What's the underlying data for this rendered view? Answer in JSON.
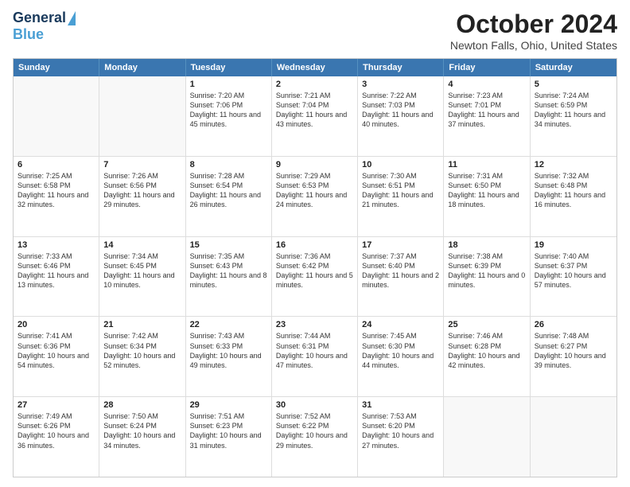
{
  "header": {
    "logo_line1": "General",
    "logo_line2": "Blue",
    "month": "October 2024",
    "location": "Newton Falls, Ohio, United States"
  },
  "calendar": {
    "days_of_week": [
      "Sunday",
      "Monday",
      "Tuesday",
      "Wednesday",
      "Thursday",
      "Friday",
      "Saturday"
    ],
    "weeks": [
      [
        {
          "day": "",
          "sunrise": "",
          "sunset": "",
          "daylight": ""
        },
        {
          "day": "",
          "sunrise": "",
          "sunset": "",
          "daylight": ""
        },
        {
          "day": "1",
          "sunrise": "Sunrise: 7:20 AM",
          "sunset": "Sunset: 7:06 PM",
          "daylight": "Daylight: 11 hours and 45 minutes."
        },
        {
          "day": "2",
          "sunrise": "Sunrise: 7:21 AM",
          "sunset": "Sunset: 7:04 PM",
          "daylight": "Daylight: 11 hours and 43 minutes."
        },
        {
          "day": "3",
          "sunrise": "Sunrise: 7:22 AM",
          "sunset": "Sunset: 7:03 PM",
          "daylight": "Daylight: 11 hours and 40 minutes."
        },
        {
          "day": "4",
          "sunrise": "Sunrise: 7:23 AM",
          "sunset": "Sunset: 7:01 PM",
          "daylight": "Daylight: 11 hours and 37 minutes."
        },
        {
          "day": "5",
          "sunrise": "Sunrise: 7:24 AM",
          "sunset": "Sunset: 6:59 PM",
          "daylight": "Daylight: 11 hours and 34 minutes."
        }
      ],
      [
        {
          "day": "6",
          "sunrise": "Sunrise: 7:25 AM",
          "sunset": "Sunset: 6:58 PM",
          "daylight": "Daylight: 11 hours and 32 minutes."
        },
        {
          "day": "7",
          "sunrise": "Sunrise: 7:26 AM",
          "sunset": "Sunset: 6:56 PM",
          "daylight": "Daylight: 11 hours and 29 minutes."
        },
        {
          "day": "8",
          "sunrise": "Sunrise: 7:28 AM",
          "sunset": "Sunset: 6:54 PM",
          "daylight": "Daylight: 11 hours and 26 minutes."
        },
        {
          "day": "9",
          "sunrise": "Sunrise: 7:29 AM",
          "sunset": "Sunset: 6:53 PM",
          "daylight": "Daylight: 11 hours and 24 minutes."
        },
        {
          "day": "10",
          "sunrise": "Sunrise: 7:30 AM",
          "sunset": "Sunset: 6:51 PM",
          "daylight": "Daylight: 11 hours and 21 minutes."
        },
        {
          "day": "11",
          "sunrise": "Sunrise: 7:31 AM",
          "sunset": "Sunset: 6:50 PM",
          "daylight": "Daylight: 11 hours and 18 minutes."
        },
        {
          "day": "12",
          "sunrise": "Sunrise: 7:32 AM",
          "sunset": "Sunset: 6:48 PM",
          "daylight": "Daylight: 11 hours and 16 minutes."
        }
      ],
      [
        {
          "day": "13",
          "sunrise": "Sunrise: 7:33 AM",
          "sunset": "Sunset: 6:46 PM",
          "daylight": "Daylight: 11 hours and 13 minutes."
        },
        {
          "day": "14",
          "sunrise": "Sunrise: 7:34 AM",
          "sunset": "Sunset: 6:45 PM",
          "daylight": "Daylight: 11 hours and 10 minutes."
        },
        {
          "day": "15",
          "sunrise": "Sunrise: 7:35 AM",
          "sunset": "Sunset: 6:43 PM",
          "daylight": "Daylight: 11 hours and 8 minutes."
        },
        {
          "day": "16",
          "sunrise": "Sunrise: 7:36 AM",
          "sunset": "Sunset: 6:42 PM",
          "daylight": "Daylight: 11 hours and 5 minutes."
        },
        {
          "day": "17",
          "sunrise": "Sunrise: 7:37 AM",
          "sunset": "Sunset: 6:40 PM",
          "daylight": "Daylight: 11 hours and 2 minutes."
        },
        {
          "day": "18",
          "sunrise": "Sunrise: 7:38 AM",
          "sunset": "Sunset: 6:39 PM",
          "daylight": "Daylight: 11 hours and 0 minutes."
        },
        {
          "day": "19",
          "sunrise": "Sunrise: 7:40 AM",
          "sunset": "Sunset: 6:37 PM",
          "daylight": "Daylight: 10 hours and 57 minutes."
        }
      ],
      [
        {
          "day": "20",
          "sunrise": "Sunrise: 7:41 AM",
          "sunset": "Sunset: 6:36 PM",
          "daylight": "Daylight: 10 hours and 54 minutes."
        },
        {
          "day": "21",
          "sunrise": "Sunrise: 7:42 AM",
          "sunset": "Sunset: 6:34 PM",
          "daylight": "Daylight: 10 hours and 52 minutes."
        },
        {
          "day": "22",
          "sunrise": "Sunrise: 7:43 AM",
          "sunset": "Sunset: 6:33 PM",
          "daylight": "Daylight: 10 hours and 49 minutes."
        },
        {
          "day": "23",
          "sunrise": "Sunrise: 7:44 AM",
          "sunset": "Sunset: 6:31 PM",
          "daylight": "Daylight: 10 hours and 47 minutes."
        },
        {
          "day": "24",
          "sunrise": "Sunrise: 7:45 AM",
          "sunset": "Sunset: 6:30 PM",
          "daylight": "Daylight: 10 hours and 44 minutes."
        },
        {
          "day": "25",
          "sunrise": "Sunrise: 7:46 AM",
          "sunset": "Sunset: 6:28 PM",
          "daylight": "Daylight: 10 hours and 42 minutes."
        },
        {
          "day": "26",
          "sunrise": "Sunrise: 7:48 AM",
          "sunset": "Sunset: 6:27 PM",
          "daylight": "Daylight: 10 hours and 39 minutes."
        }
      ],
      [
        {
          "day": "27",
          "sunrise": "Sunrise: 7:49 AM",
          "sunset": "Sunset: 6:26 PM",
          "daylight": "Daylight: 10 hours and 36 minutes."
        },
        {
          "day": "28",
          "sunrise": "Sunrise: 7:50 AM",
          "sunset": "Sunset: 6:24 PM",
          "daylight": "Daylight: 10 hours and 34 minutes."
        },
        {
          "day": "29",
          "sunrise": "Sunrise: 7:51 AM",
          "sunset": "Sunset: 6:23 PM",
          "daylight": "Daylight: 10 hours and 31 minutes."
        },
        {
          "day": "30",
          "sunrise": "Sunrise: 7:52 AM",
          "sunset": "Sunset: 6:22 PM",
          "daylight": "Daylight: 10 hours and 29 minutes."
        },
        {
          "day": "31",
          "sunrise": "Sunrise: 7:53 AM",
          "sunset": "Sunset: 6:20 PM",
          "daylight": "Daylight: 10 hours and 27 minutes."
        },
        {
          "day": "",
          "sunrise": "",
          "sunset": "",
          "daylight": ""
        },
        {
          "day": "",
          "sunrise": "",
          "sunset": "",
          "daylight": ""
        }
      ]
    ]
  }
}
